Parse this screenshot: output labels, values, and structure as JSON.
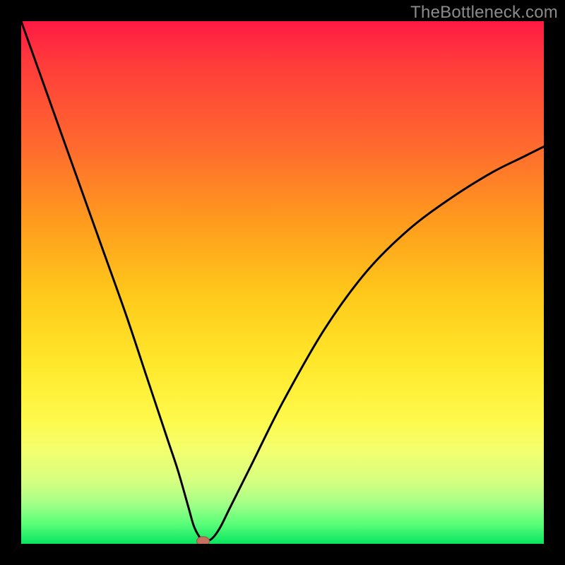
{
  "watermark": "TheBottleneck.com",
  "colors": {
    "frame": "#000000",
    "curve": "#000000",
    "marker_fill": "#c6705f",
    "marker_stroke": "#9a4e40"
  },
  "chart_data": {
    "type": "line",
    "title": "",
    "xlabel": "",
    "ylabel": "",
    "xlim": [
      0,
      100
    ],
    "ylim": [
      0,
      100
    ],
    "grid": false,
    "legend": false,
    "series": [
      {
        "name": "bottleneck-curve",
        "x": [
          0,
          5,
          10,
          15,
          20,
          24,
          28,
          30,
          32,
          33,
          34,
          35,
          36.5,
          38,
          40,
          44,
          50,
          58,
          66,
          74,
          82,
          90,
          96,
          100
        ],
        "y": [
          100,
          86,
          72,
          58,
          44,
          32,
          20,
          14,
          7,
          3.5,
          1.5,
          0.5,
          1,
          3,
          7,
          15,
          27,
          41,
          52,
          60,
          66,
          71,
          74,
          76
        ]
      }
    ],
    "marker": {
      "x": 34.8,
      "y": 0.5,
      "rx": 1.2,
      "ry": 0.9
    },
    "gradient_stops": [
      {
        "pos": 0,
        "color": "#ff1a44"
      },
      {
        "pos": 24,
        "color": "#ff6a2e"
      },
      {
        "pos": 52,
        "color": "#ffc81a"
      },
      {
        "pos": 76,
        "color": "#fff94a"
      },
      {
        "pos": 92,
        "color": "#a8ff88"
      },
      {
        "pos": 100,
        "color": "#08e560"
      }
    ]
  }
}
